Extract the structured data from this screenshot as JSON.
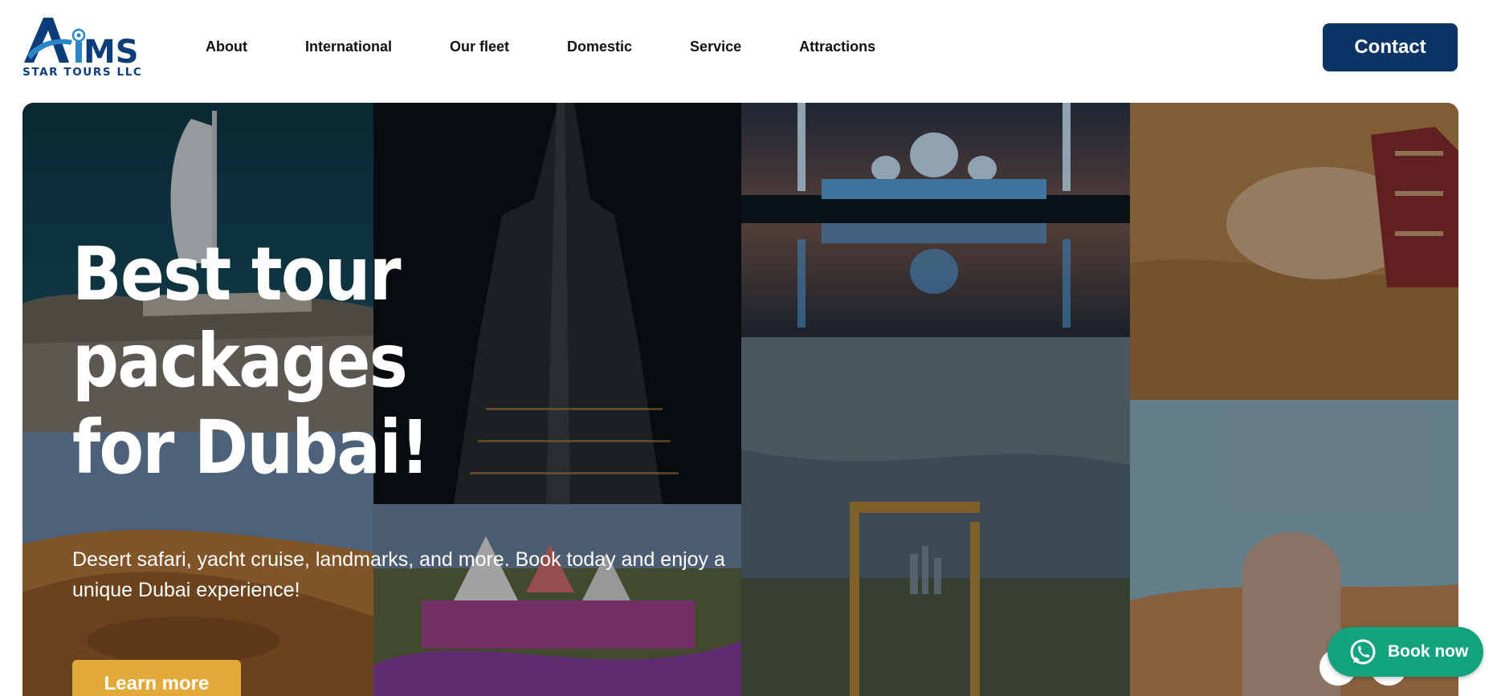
{
  "logo": {
    "brand_text": "AIMS",
    "subtitle": "STAR TOURS LLC",
    "brand_color": "#0c3d7a",
    "accent_color": "#2a86c9"
  },
  "nav": {
    "items": [
      {
        "label": "About"
      },
      {
        "label": "International"
      },
      {
        "label": "Our fleet"
      },
      {
        "label": "Domestic"
      },
      {
        "label": "Service"
      },
      {
        "label": "Attractions"
      }
    ]
  },
  "header": {
    "contact_label": "Contact"
  },
  "hero": {
    "title_line1": "Best tour packages",
    "title_line2": "for Dubai!",
    "description": "Desert safari, yacht cruise, landmarks, and more. Book today and enjoy a unique Dubai experience!",
    "cta_label": "Learn more",
    "images": [
      "burj-al-arab",
      "burj-khalifa",
      "sheikh-zayed-mosque",
      "camel",
      "desert-dunes",
      "miracle-garden",
      "dubai-frame",
      "desert-tourist"
    ]
  },
  "floating": {
    "book_label": "Book now",
    "icon": "whatsapp-icon"
  },
  "colors": {
    "primary": "#0c3467",
    "cta": "#e2a93b",
    "whatsapp": "#12a37e"
  }
}
